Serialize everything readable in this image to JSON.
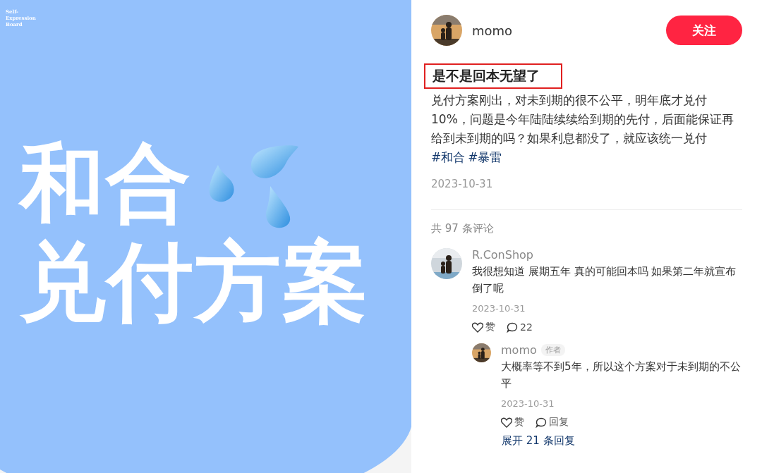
{
  "post_image": {
    "caption": "Self-Expression Board",
    "headline_lines": [
      "和合",
      "兑付方案"
    ]
  },
  "author": {
    "name": "momo"
  },
  "follow_button": "关注",
  "title": {
    "text": "是不是回本无望了",
    "highlighted": true
  },
  "body": "兑付方案刚出，对未到期的很不公平，明年底才兑付10%，问题是今年陆陆续续给到期的先付，后面能保证再给到未到期的吗？如果利息都没了，就应该统一兑付",
  "tags": [
    "#和合",
    "#暴雷"
  ],
  "date": "2023-10-31",
  "comment_count": "共 97 条评论",
  "comments": [
    {
      "name": "R.ConShop",
      "text": "我很想知道 展期五年 真的可能回本吗 如果第二年就宣布倒了呢",
      "date": "2023-10-31",
      "actions": [
        {
          "kind": "like",
          "label": "赞"
        },
        {
          "kind": "reply",
          "label": "22"
        }
      ],
      "replies": [
        {
          "name": "momo",
          "badge": "作者",
          "text": "大概率等不到5年，所以这个方案对于未到期的不公平",
          "date": "2023-10-31",
          "actions": [
            {
              "kind": "like",
              "label": "赞"
            },
            {
              "kind": "reply",
              "label": "回复"
            }
          ]
        }
      ],
      "more_replies": "展开 21 条回复"
    }
  ]
}
